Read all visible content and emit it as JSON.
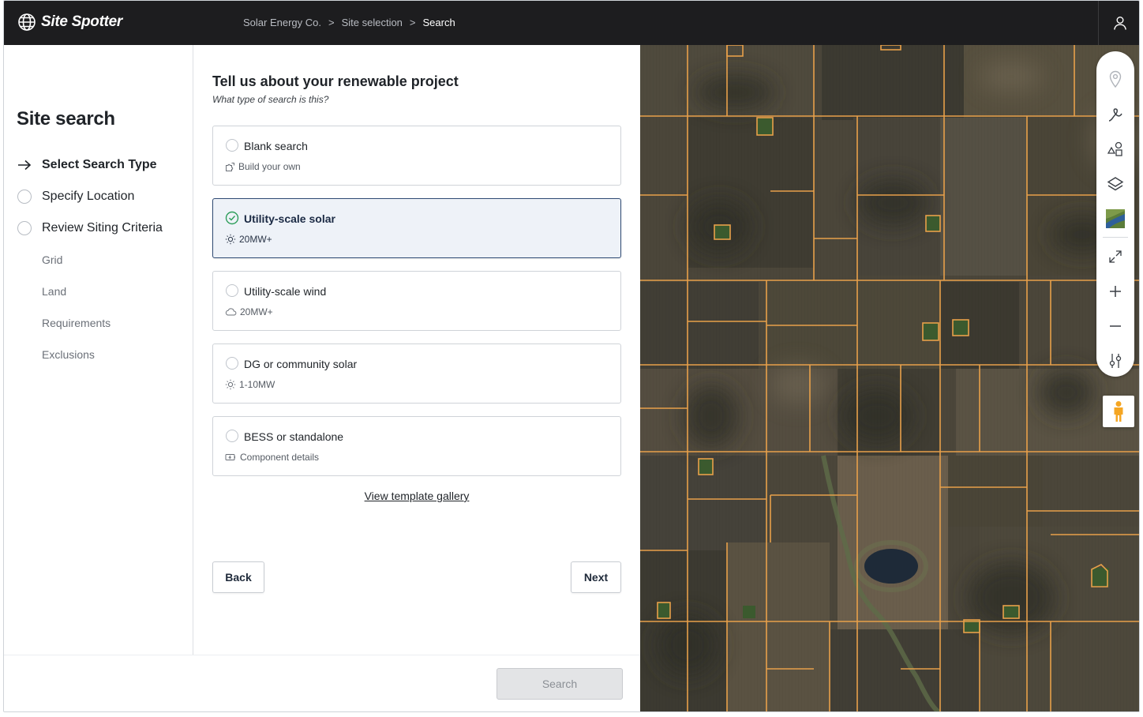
{
  "app": {
    "name": "Site Spotter"
  },
  "breadcrumbs": [
    "Solar Energy Co.",
    ">",
    "Site selection",
    ">",
    "Search"
  ],
  "sidebar": {
    "title": "Site search",
    "steps": [
      {
        "label": "Select Search Type",
        "state": "current"
      },
      {
        "label": "Specify Location",
        "state": "pending"
      },
      {
        "label": "Review Siting Criteria",
        "state": "pending"
      }
    ],
    "substeps": [
      "Grid",
      "Land",
      "Requirements",
      "Exclusions"
    ]
  },
  "form": {
    "title": "Tell us about your renewable project",
    "subtitle": "What type of search is this?",
    "options": [
      {
        "label": "Blank search",
        "detail": "Build your own",
        "icon": "puzzle-icon",
        "selected": false
      },
      {
        "label": "Utility-scale solar",
        "detail": "20MW+",
        "icon": "sun-icon",
        "selected": true
      },
      {
        "label": "Utility-scale wind",
        "detail": "20MW+",
        "icon": "cloud-icon",
        "selected": false
      },
      {
        "label": "DG or community solar",
        "detail": "1-10MW",
        "icon": "sun-icon",
        "selected": false
      },
      {
        "label": "BESS or standalone",
        "detail": "Component details",
        "icon": "battery-icon",
        "selected": false
      }
    ],
    "gallery_link": "View template gallery",
    "back_label": "Back",
    "next_label": "Next"
  },
  "footer": {
    "search_label": "Search",
    "search_enabled": false
  },
  "map": {
    "tools": [
      "marker-icon",
      "draw-line-icon",
      "shapes-icon",
      "layers-icon",
      "basemap-thumbnail",
      "expand-icon",
      "zoom-in-icon",
      "zoom-out-icon",
      "filter-sliders-icon"
    ],
    "street_view": "pegman-icon"
  },
  "colors": {
    "topbar": "#1d1d1f",
    "accent_selected_border": "#2f4a73",
    "selected_check": "#2e9e5b",
    "parcel_outline": "#e8a04a"
  }
}
